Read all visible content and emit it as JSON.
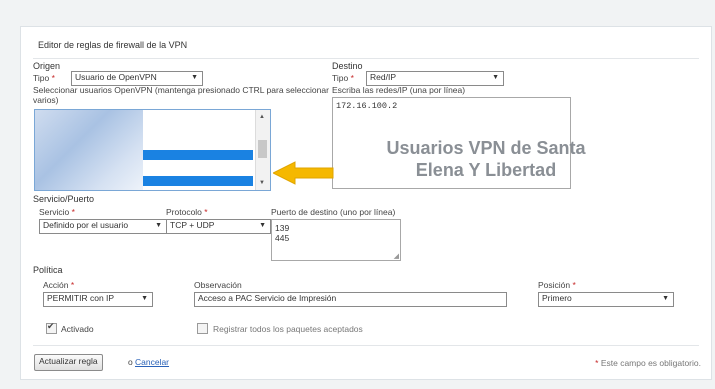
{
  "editor": {
    "title": "Editor de reglas de firewall de la VPN",
    "origin": {
      "section": "Origen",
      "type_label": "Tipo",
      "type_value": "Usuario de OpenVPN",
      "help": "Seleccionar usuarios OpenVPN (mantenga presionado CTRL para seleccionar varios)"
    },
    "destination": {
      "section": "Destino",
      "type_label": "Tipo",
      "type_value": "Red/IP",
      "help": "Escriba las redes/IP (una por línea)",
      "value": "172.16.100.2"
    },
    "service": {
      "section": "Servicio/Puerto",
      "service_label": "Servicio",
      "service_value": "Definido por el usuario",
      "protocol_label": "Protocolo",
      "protocol_value": "TCP + UDP",
      "port_label": "Puerto de destino (uno por línea)",
      "ports": "139\n445"
    },
    "policy": {
      "section": "Política",
      "action_label": "Acción",
      "action_value": "PERMITIR con IP",
      "remark_label": "Observación",
      "remark_value": "Acceso a PAC Servicio de Impresión",
      "position_label": "Posición",
      "position_value": "Primero"
    },
    "enabled_label": "Activado",
    "log_label": "Registrar todos los paquetes aceptados",
    "update_button": "Actualizar regla",
    "or_text": "o",
    "cancel_link": "Cancelar",
    "required_note": "Este campo es obligatorio.",
    "required_mark": "*"
  },
  "annotation": {
    "line1": "Usuarios VPN de Santa",
    "line2": "Elena Y Libertad",
    "arrow_color": "#f5b800"
  },
  "colors": {
    "selected": "#1a82e2",
    "required": "#c62828",
    "link": "#2a62b8"
  }
}
